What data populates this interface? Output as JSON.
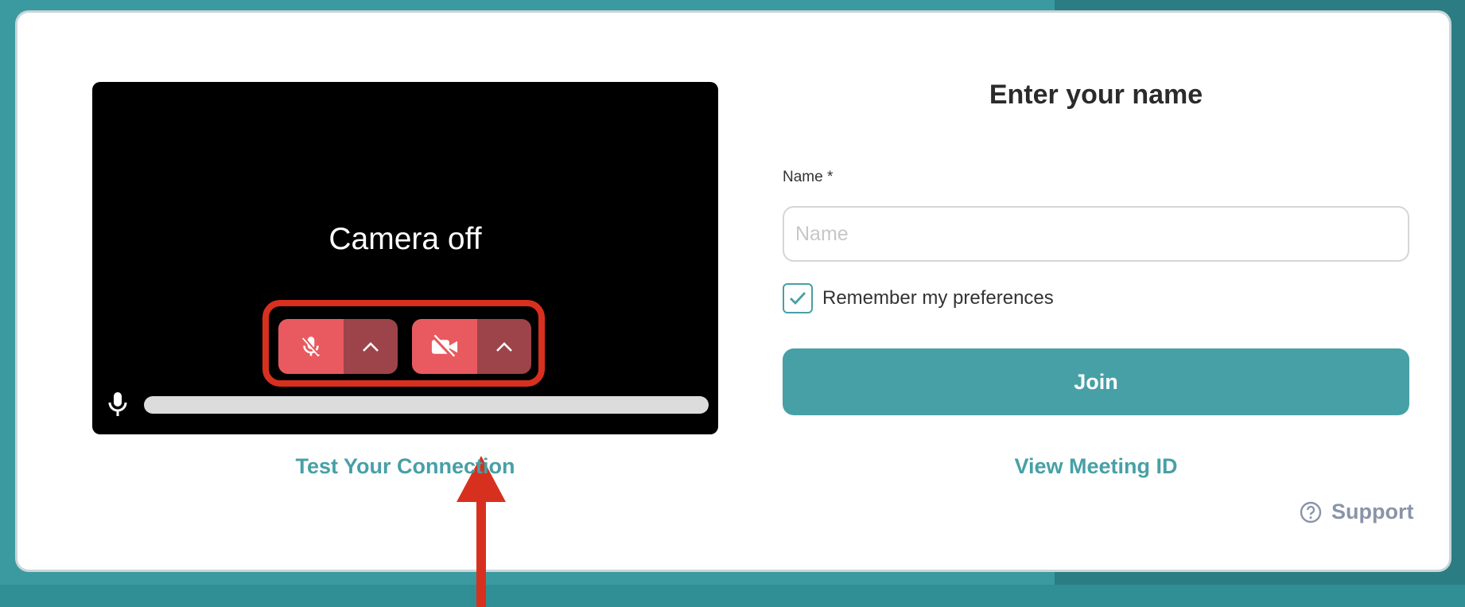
{
  "colors": {
    "accent": "#47a0a6",
    "annotation_red": "#d8301f",
    "control_red": "#e85a60",
    "control_dark_red": "#9c4449",
    "support_gray": "#8a94a8"
  },
  "preview": {
    "status_text": "Camera off",
    "mic_control": {
      "icon": "mic-muted-icon",
      "caret_icon": "chevron-up-icon"
    },
    "camera_control": {
      "icon": "camera-off-icon",
      "caret_icon": "chevron-up-icon"
    },
    "audio_level": {
      "icon": "mic-icon",
      "level": 0
    },
    "annotation": {
      "highlight": "red-outline-box",
      "pointer": "red-arrow-up"
    }
  },
  "links": {
    "test_connection": "Test Your Connection",
    "view_meeting_id": "View Meeting ID",
    "support": "Support",
    "support_icon": "question-circle-icon"
  },
  "form": {
    "heading": "Enter your name",
    "name_label": "Name *",
    "name_value": "",
    "name_placeholder": "Name",
    "remember_label": "Remember my preferences",
    "remember_checked": true,
    "join_label": "Join"
  }
}
